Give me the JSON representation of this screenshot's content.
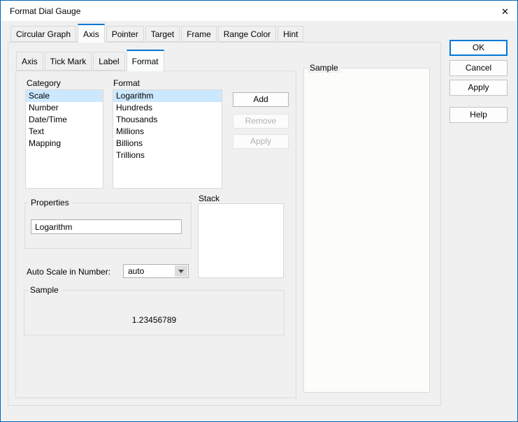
{
  "window": {
    "title": "Format Dial Gauge",
    "close_icon": "✕"
  },
  "main_tabs": {
    "active": "Axis",
    "items": [
      {
        "label": "Circular Graph"
      },
      {
        "label": "Axis"
      },
      {
        "label": "Pointer"
      },
      {
        "label": "Target"
      },
      {
        "label": "Frame"
      },
      {
        "label": "Range Color"
      },
      {
        "label": "Hint"
      }
    ]
  },
  "sub_tabs": {
    "active": "Format",
    "items": [
      {
        "label": "Axis"
      },
      {
        "label": "Tick Mark"
      },
      {
        "label": "Label"
      },
      {
        "label": "Format"
      }
    ]
  },
  "format_page": {
    "category_list": {
      "label": "Category",
      "items": [
        "Scale",
        "Number",
        "Date/Time",
        "Text",
        "Mapping"
      ],
      "selected": "Scale"
    },
    "format_list": {
      "label": "Format",
      "items": [
        "Logarithm",
        "Hundreds",
        "Thousands",
        "Millions",
        "Billions",
        "Trillions"
      ],
      "selected": "Logarithm"
    },
    "buttons": {
      "add": "Add",
      "remove": "Remove",
      "apply": "Apply"
    },
    "properties": {
      "label": "Properties",
      "value": "Logarithm"
    },
    "stack": {
      "label": "Stack"
    },
    "auto_scale": {
      "label": "Auto Scale in Number:",
      "value": "auto"
    },
    "sample": {
      "label": "Sample",
      "value": "1.23456789"
    }
  },
  "preview": {
    "label": "Sample"
  },
  "action_buttons": {
    "ok": "OK",
    "cancel": "Cancel",
    "apply": "Apply",
    "help": "Help"
  },
  "colors": {
    "accent": "#0078d7",
    "selection": "#cce8ff",
    "dialog_border": "#0067b8"
  }
}
